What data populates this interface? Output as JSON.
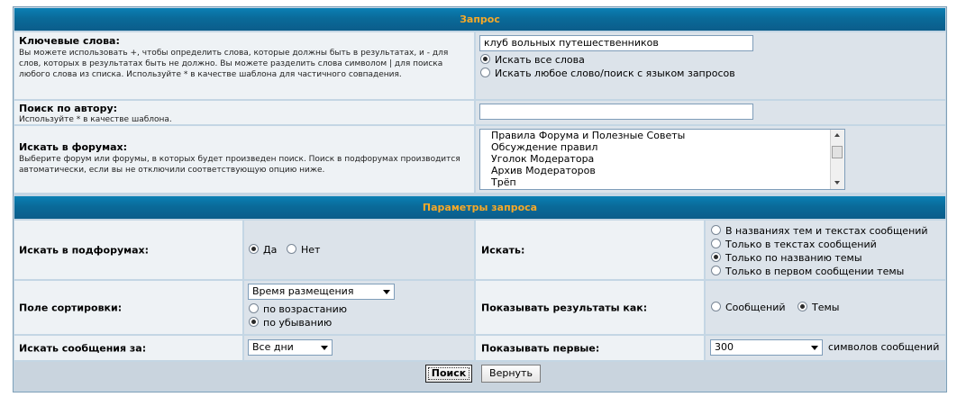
{
  "query_section": {
    "title": "Запрос",
    "keywords": {
      "label": "Ключевые слова:",
      "help": "Вы можете использовать +, чтобы определить слова, которые должны быть в результатах, и - для слов, которых в результатах быть не должно. Вы можете разделить слова символом | для поиска любого слова из списка. Используйте * в качестве шаблона для частичного совпадения.",
      "value": "клуб вольных путешественников",
      "options": [
        {
          "label": "Искать все слова",
          "checked": true
        },
        {
          "label": "Искать любое слово/поиск с языком запросов",
          "checked": false
        }
      ]
    },
    "author": {
      "label": "Поиск по автору:",
      "help": "Используйте * в качестве шаблона.",
      "value": ""
    },
    "forums": {
      "label": "Искать в форумах:",
      "help": "Выберите форум или форумы, в которых будет произведен поиск. Поиск в подфорумах производится автоматически, если вы не отключили соответствующую опцию ниже.",
      "items": [
        "Правила Форума и Полезные Советы",
        "Обсуждение правил",
        "Уголок Модератора",
        "Архив Модераторов",
        "Трёп"
      ]
    }
  },
  "params_section": {
    "title": "Параметры запроса",
    "subforums": {
      "label": "Искать в подфорумах:",
      "options": [
        {
          "label": "Да",
          "checked": true
        },
        {
          "label": "Нет",
          "checked": false
        }
      ]
    },
    "search_in": {
      "label": "Искать:",
      "options": [
        {
          "label": "В названиях тем и текстах сообщений",
          "checked": false
        },
        {
          "label": "Только в текстах сообщений",
          "checked": false
        },
        {
          "label": "Только по названию темы",
          "checked": true
        },
        {
          "label": "Только в первом сообщении темы",
          "checked": false
        }
      ]
    },
    "sort": {
      "label": "Поле сортировки:",
      "selected": "Время размещения",
      "options": [
        {
          "label": "по возрастанию",
          "checked": false
        },
        {
          "label": "по убыванию",
          "checked": true
        }
      ]
    },
    "display": {
      "label": "Показывать результаты как:",
      "options": [
        {
          "label": "Сообщений",
          "checked": false
        },
        {
          "label": "Темы",
          "checked": true
        }
      ]
    },
    "period": {
      "label": "Искать сообщения за:",
      "selected": "Все дни"
    },
    "show_first": {
      "label": "Показывать первые:",
      "selected": "300",
      "suffix": "символов сообщений"
    }
  },
  "buttons": {
    "search": "Поиск",
    "reset": "Вернуть"
  },
  "colors": {
    "header_bg": "#0b6a99",
    "header_text": "#f7a928",
    "cell_light": "#eef2f5",
    "cell_dark": "#dce3ea",
    "border": "#c4d6e4"
  }
}
